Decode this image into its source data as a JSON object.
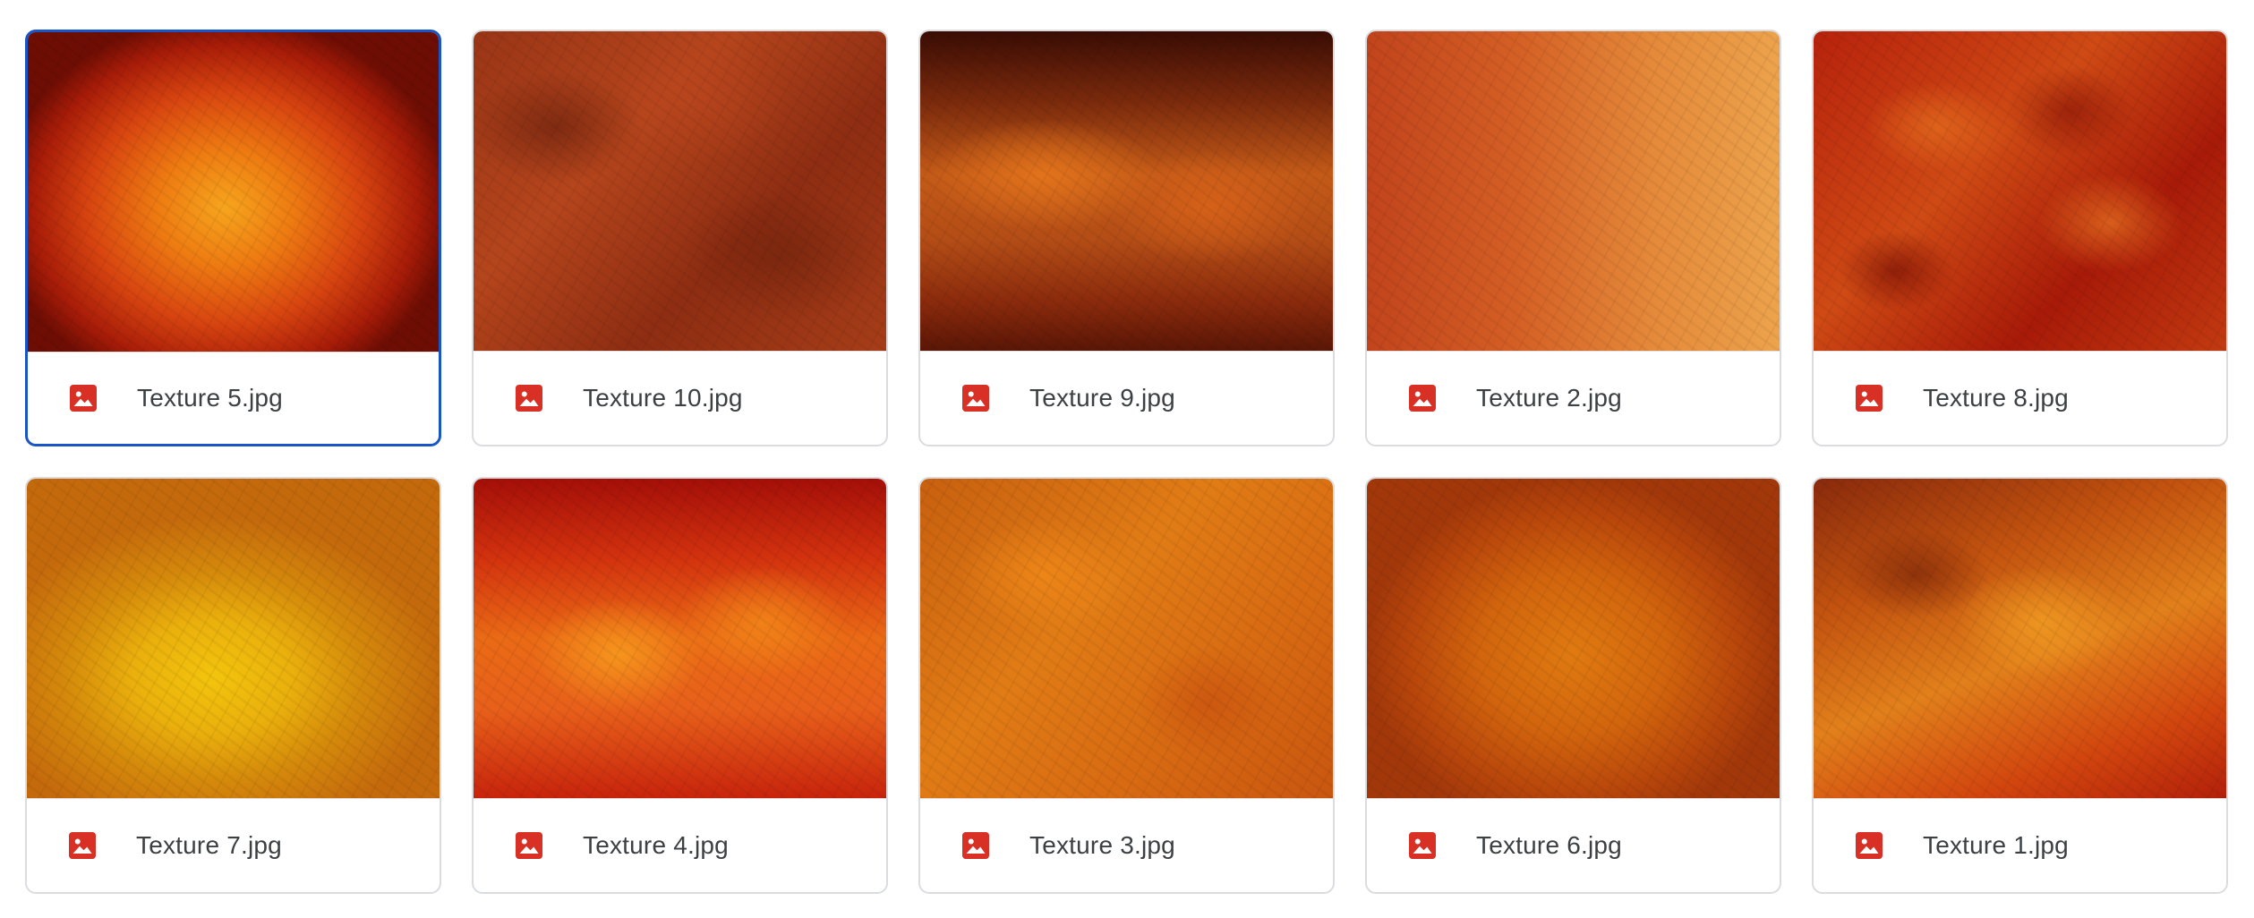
{
  "files": [
    {
      "name": "Texture 5.jpg",
      "texture": "t5",
      "selected": true,
      "icon": "image-file-icon"
    },
    {
      "name": "Texture 10.jpg",
      "texture": "t10",
      "selected": false,
      "icon": "image-file-icon"
    },
    {
      "name": "Texture 9.jpg",
      "texture": "t9",
      "selected": false,
      "icon": "image-file-icon"
    },
    {
      "name": "Texture 2.jpg",
      "texture": "t2",
      "selected": false,
      "icon": "image-file-icon"
    },
    {
      "name": "Texture 8.jpg",
      "texture": "t8",
      "selected": false,
      "icon": "image-file-icon"
    },
    {
      "name": "Texture 7.jpg",
      "texture": "t7",
      "selected": false,
      "icon": "image-file-icon"
    },
    {
      "name": "Texture 4.jpg",
      "texture": "t4",
      "selected": false,
      "icon": "image-file-icon"
    },
    {
      "name": "Texture 3.jpg",
      "texture": "t3",
      "selected": false,
      "icon": "image-file-icon"
    },
    {
      "name": "Texture 6.jpg",
      "texture": "t6",
      "selected": false,
      "icon": "image-file-icon"
    },
    {
      "name": "Texture 1.jpg",
      "texture": "t1",
      "selected": false,
      "icon": "image-file-icon"
    }
  ],
  "colors": {
    "icon": "#d93025",
    "selection_border": "#1a55c7",
    "card_border": "#dadce0",
    "text": "#3c4043"
  }
}
